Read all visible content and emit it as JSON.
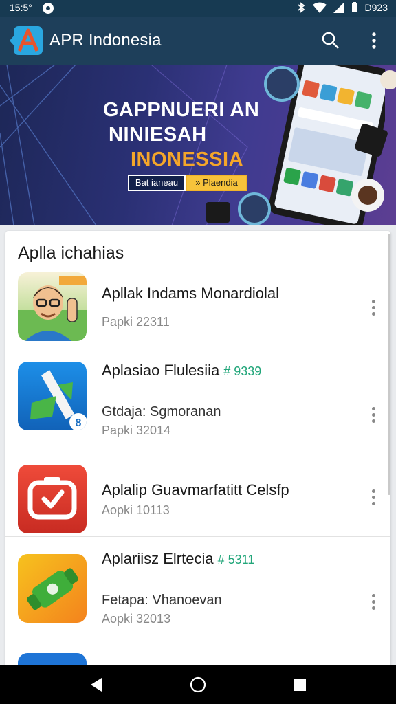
{
  "status_bar": {
    "time": "15:5°",
    "clock": "D923"
  },
  "app_bar": {
    "title": "APR Indonesia",
    "icons": [
      "app-logo-icon",
      "search-icon",
      "more-vertical-icon"
    ]
  },
  "banner": {
    "headline_1": "GAPPNUERI AN",
    "headline_2": "NINIESAH",
    "headline_3": "INONESSIA",
    "button_1": "Bat ianeau",
    "button_2": "Plaendia",
    "colors": {
      "accent": "#f4a62a",
      "button2": "#f7c33b"
    }
  },
  "section": {
    "title": "Aplla ichahias",
    "items": [
      {
        "title": "Apllak Indams Monardiolal",
        "tag": "",
        "subtitle": "",
        "meta": "Papki 22311",
        "icon": "avatar-thumbs-up-icon"
      },
      {
        "title": "Aplasiao Flulesiia",
        "tag": "# 9339",
        "subtitle": "Gtdaja: Sgmoranan",
        "meta": "Papki 32014",
        "icon": "blue-diagonal-app-icon"
      },
      {
        "title": "Aplalip Guavmarfatitt Celsfp",
        "tag": "",
        "subtitle": "",
        "meta": "Aopki 10113",
        "icon": "red-camera-app-icon"
      },
      {
        "title": "Aplariisz Elrtecia",
        "tag": "# 5311",
        "subtitle": "Fetapa: Vhanoevan",
        "meta": "Aopki 32013",
        "icon": "orange-green-app-icon"
      }
    ]
  },
  "nav": {
    "icons": [
      "back-icon",
      "home-icon",
      "recents-icon"
    ]
  }
}
